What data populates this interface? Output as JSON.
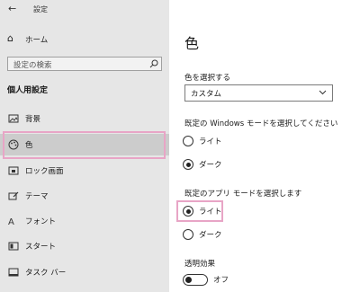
{
  "window": {
    "title": "設定",
    "back_icon": "back-arrow-icon"
  },
  "sidebar": {
    "home_label": "ホーム",
    "search_placeholder": "設定の検索",
    "section_title": "個人用設定",
    "items": [
      {
        "label": "背景",
        "icon": "picture-icon",
        "active": false
      },
      {
        "label": "色",
        "icon": "palette-icon",
        "active": true
      },
      {
        "label": "ロック画面",
        "icon": "lock-screen-icon",
        "active": false
      },
      {
        "label": "テーマ",
        "icon": "theme-brush-icon",
        "active": false
      },
      {
        "label": "フォント",
        "icon": "font-icon",
        "active": false
      },
      {
        "label": "スタート",
        "icon": "start-icon",
        "active": false
      },
      {
        "label": "タスク バー",
        "icon": "taskbar-icon",
        "active": false
      }
    ]
  },
  "main": {
    "title": "色",
    "choose_color_label": "色を選択する",
    "choose_color_value": "カスタム",
    "windows_mode": {
      "label": "既定の Windows モードを選択してください",
      "options": [
        {
          "label": "ライト",
          "checked": false
        },
        {
          "label": "ダーク",
          "checked": true
        }
      ]
    },
    "app_mode": {
      "label": "既定のアプリ モードを選択します",
      "options": [
        {
          "label": "ライト",
          "checked": true
        },
        {
          "label": "ダーク",
          "checked": false
        }
      ]
    },
    "transparency": {
      "label": "透明効果",
      "state": "オフ"
    }
  },
  "colors": {
    "sidebar_bg": "#e6e6e6",
    "active_item_bg": "#cccccc",
    "highlight": "#e8a5c6"
  }
}
